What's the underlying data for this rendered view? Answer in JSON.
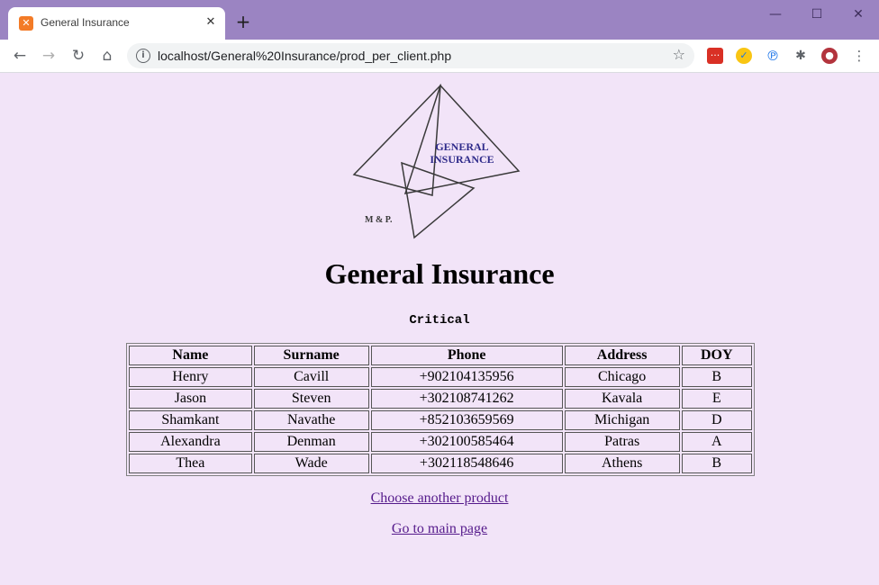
{
  "browser": {
    "tab_title": "General Insurance",
    "url": "localhost/General%20Insurance/prod_per_client.php",
    "icons": {
      "favicon": "xampp-icon",
      "back": "arrow-left-icon",
      "forward": "arrow-right-icon",
      "reload": "reload-icon",
      "home": "home-icon",
      "info": "info-icon",
      "bookmark": "star-icon",
      "extensions": "puzzle-icon",
      "menu": "kebab-menu-icon"
    }
  },
  "logo": {
    "line1": "GENERAL",
    "line2": "INSURANCE",
    "tag": "M & P."
  },
  "page": {
    "title": "General Insurance",
    "product": "Critical"
  },
  "table": {
    "headers": [
      "Name",
      "Surname",
      "Phone",
      "Address",
      "DOY"
    ],
    "rows": [
      [
        "Henry",
        "Cavill",
        "+902104135956",
        "Chicago",
        "B"
      ],
      [
        "Jason",
        "Steven",
        "+302108741262",
        "Kavala",
        "E"
      ],
      [
        "Shamkant",
        "Navathe",
        "+852103659569",
        "Michigan",
        "D"
      ],
      [
        "Alexandra",
        "Denman",
        "+302100585464",
        "Patras",
        "A"
      ],
      [
        "Thea",
        "Wade",
        "+302118548646",
        "Athens",
        "B"
      ]
    ]
  },
  "links": {
    "another_product": "Choose another product",
    "main_page": "Go to main page"
  },
  "colors": {
    "page_bg": "#f2e4f8",
    "titlebar": "#9b84c2",
    "link": "#551a8b",
    "logo_text": "#2e2a8a"
  }
}
